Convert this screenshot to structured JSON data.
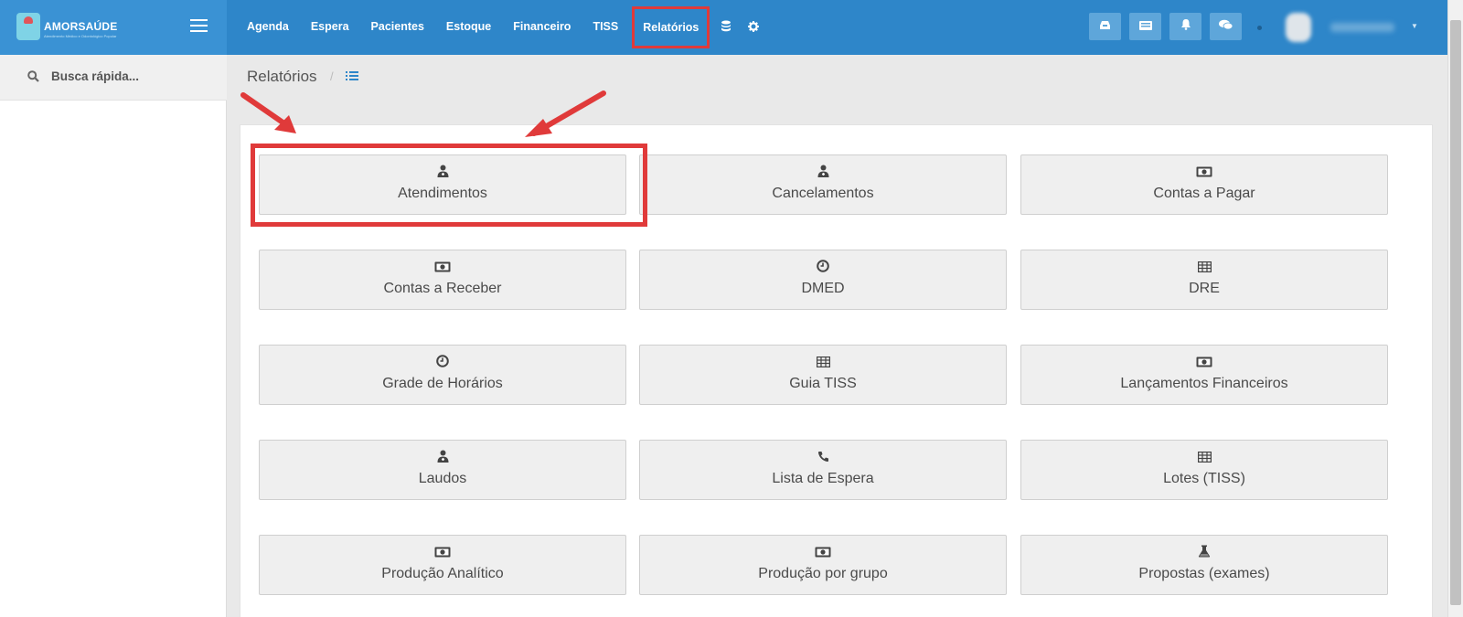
{
  "brand": {
    "name": "AMORSAÚDE",
    "subtitle": "Atendimento Médico e Odontológico Popular"
  },
  "nav": {
    "items": [
      {
        "label": "Agenda"
      },
      {
        "label": "Espera"
      },
      {
        "label": "Pacientes"
      },
      {
        "label": "Estoque"
      },
      {
        "label": "Financeiro"
      },
      {
        "label": "TISS"
      },
      {
        "label": "Relatórios",
        "active": true
      }
    ],
    "extra_icons": [
      "database-icon",
      "gear-icon"
    ]
  },
  "topbar_buttons": [
    "inbox-icon",
    "list-card-icon",
    "bell-icon",
    "chat-icon"
  ],
  "search": {
    "placeholder": "Busca rápida..."
  },
  "breadcrumb": {
    "title": "Relatórios",
    "separator": "/",
    "icon": "list-icon"
  },
  "reports": [
    {
      "label": "Atendimentos",
      "icon": "user-doctor-icon",
      "glyph": "👤"
    },
    {
      "label": "Cancelamentos",
      "icon": "user-doctor-icon",
      "glyph": "👤"
    },
    {
      "label": "Contas a Pagar",
      "icon": "money-icon",
      "glyph": "💵"
    },
    {
      "label": "Contas a Receber",
      "icon": "money-icon",
      "glyph": "💵"
    },
    {
      "label": "DMED",
      "icon": "clock-icon",
      "glyph": "🕘"
    },
    {
      "label": "DRE",
      "icon": "table-icon",
      "glyph": "▦"
    },
    {
      "label": "Grade de Horários",
      "icon": "clock-icon",
      "glyph": "🕘"
    },
    {
      "label": "Guia TISS",
      "icon": "table-icon",
      "glyph": "▦"
    },
    {
      "label": "Lançamentos Financeiros",
      "icon": "money-icon",
      "glyph": "💵"
    },
    {
      "label": "Laudos",
      "icon": "user-doctor-icon",
      "glyph": "👤"
    },
    {
      "label": "Lista de Espera",
      "icon": "phone-icon",
      "glyph": "📞"
    },
    {
      "label": "Lotes (TISS)",
      "icon": "table-icon",
      "glyph": "▦"
    },
    {
      "label": "Produção Analítico",
      "icon": "money-icon",
      "glyph": "💵"
    },
    {
      "label": "Produção por grupo",
      "icon": "money-icon",
      "glyph": "💵"
    },
    {
      "label": "Propostas (exames)",
      "icon": "flask-icon",
      "glyph": "⚗"
    }
  ],
  "colors": {
    "topbar": "#2e86c9",
    "brand_bg": "#3a92d4",
    "highlight": "#e03a3a",
    "tile_bg": "#efefef"
  }
}
